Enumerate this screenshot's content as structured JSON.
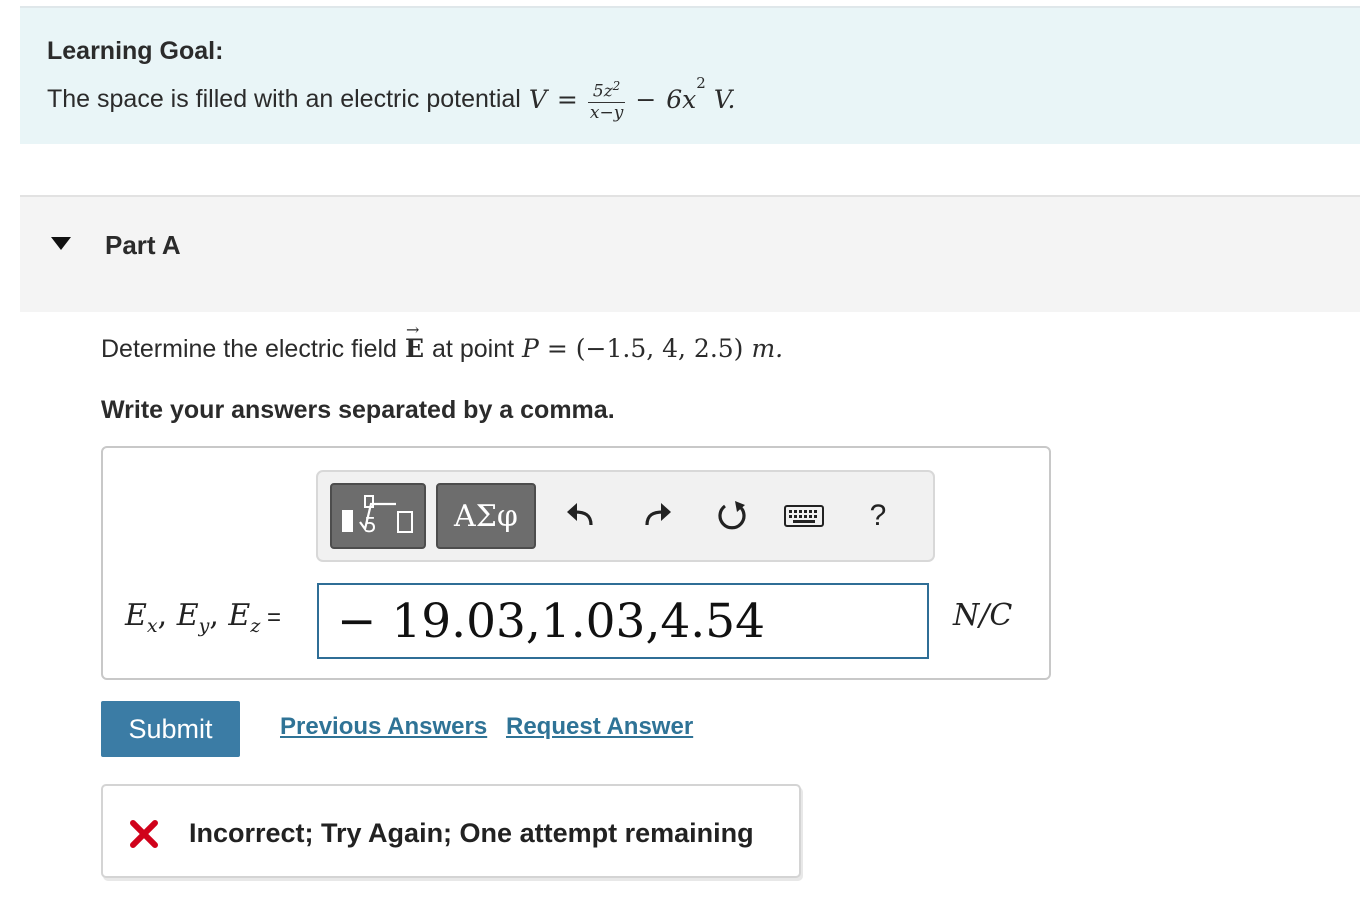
{
  "goal": {
    "title": "Learning Goal:",
    "text": "The space is filled with an electric potential",
    "var": "V",
    "eq": "=",
    "frac_num": "5z",
    "frac_num_exp": "2",
    "frac_den": "x−y",
    "minus": "−",
    "term": "6x",
    "term_exp": "2",
    "unit": "V."
  },
  "part": {
    "title": "Part A"
  },
  "question": {
    "text": "Determine the electric field",
    "symbol": "E",
    "text2": "at point",
    "point_var": "P",
    "point_value": "= (−1.5, 4, 2.5)",
    "unit": "m."
  },
  "instruction": "Write your answers separated by a comma.",
  "toolbar": {
    "symbols_label": "ΑΣφ",
    "help_label": "?"
  },
  "answer": {
    "label_ex": "E",
    "label_ex_sub": "x",
    "label_ey": "E",
    "label_ey_sub": "y",
    "label_ez": "E",
    "label_ez_sub": "z",
    "value": "− 19.03,1.03,4.54",
    "unit": "N/C"
  },
  "buttons": {
    "submit": "Submit",
    "previous": "Previous Answers",
    "request": "Request Answer"
  },
  "feedback": {
    "text": "Incorrect; Try Again; One attempt remaining",
    "color": "#d0021b"
  }
}
